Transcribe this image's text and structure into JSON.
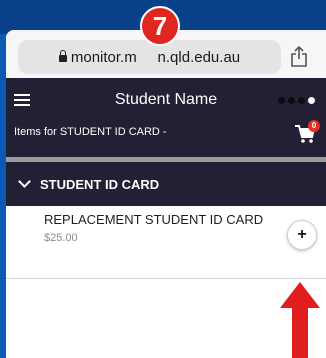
{
  "step_badge": "7",
  "browser": {
    "url": "monitor.m…n.qld.edu.au",
    "url_display": "monitor.m     n.qld.edu.au"
  },
  "header": {
    "title": "Student Name",
    "subtitle": "Items for STUDENT ID CARD -",
    "cart_count": "0"
  },
  "section": {
    "title": "STUDENT ID CARD"
  },
  "products": [
    {
      "name": "REPLACEMENT STUDENT ID CARD",
      "price": "$25.00",
      "add_label": "+"
    }
  ],
  "colors": {
    "header_bg": "#231f34",
    "frame_blue": "#0d58b5",
    "badge_red": "#e0271f",
    "arrow_red": "#e01e1e",
    "cart_badge": "#e53122"
  },
  "icons": [
    "lock-icon",
    "share-icon",
    "menu-icon",
    "more-dots-icon",
    "cart-icon",
    "chevron-down-icon",
    "plus-icon",
    "arrow-up-icon"
  ]
}
